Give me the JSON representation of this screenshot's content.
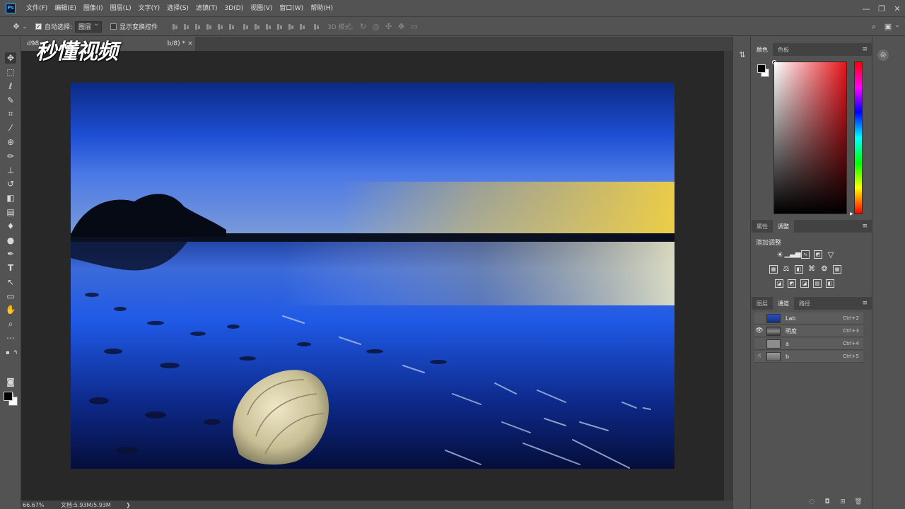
{
  "menubar": {
    "app_icon": "Ps",
    "items": [
      "文件(F)",
      "编辑(E)",
      "图像(I)",
      "图层(L)",
      "文字(Y)",
      "选择(S)",
      "滤镜(T)",
      "3D(D)",
      "视图(V)",
      "窗口(W)",
      "帮助(H)"
    ],
    "minimize": "—",
    "restore": "❐",
    "close": "✕"
  },
  "options": {
    "auto_select_label": "自动选择:",
    "auto_select_checked": true,
    "auto_select_value": "图层",
    "show_transform_label": "显示变换控件",
    "show_transform_checked": false,
    "mode_3d_label": "3D 模式:"
  },
  "document": {
    "tab_prefix": "d98",
    "tab_suffix": "b/8) *",
    "watermark": "秒懂视频",
    "zoom": "66.67%",
    "doc_info": "文档:5.93M/5.93M",
    "status_arrow": "❯"
  },
  "color_panel": {
    "tabs": [
      "颜色",
      "色板"
    ],
    "active_tab": 0,
    "foreground": "#000000",
    "background": "#ffffff"
  },
  "adjust_panel": {
    "tabs": [
      "属性",
      "调整"
    ],
    "active_tab": 1,
    "title": "添加调整"
  },
  "channels_panel": {
    "tabs": [
      "图层",
      "通道",
      "路径"
    ],
    "active_tab": 1,
    "channels": [
      {
        "name": "Lab",
        "shortcut": "Ctrl+2",
        "visible": false
      },
      {
        "name": "明度",
        "shortcut": "Ctrl+3",
        "visible": true
      },
      {
        "name": "a",
        "shortcut": "Ctrl+4",
        "visible": false
      },
      {
        "name": "b",
        "shortcut": "Ctrl+5",
        "visible": false
      }
    ]
  }
}
